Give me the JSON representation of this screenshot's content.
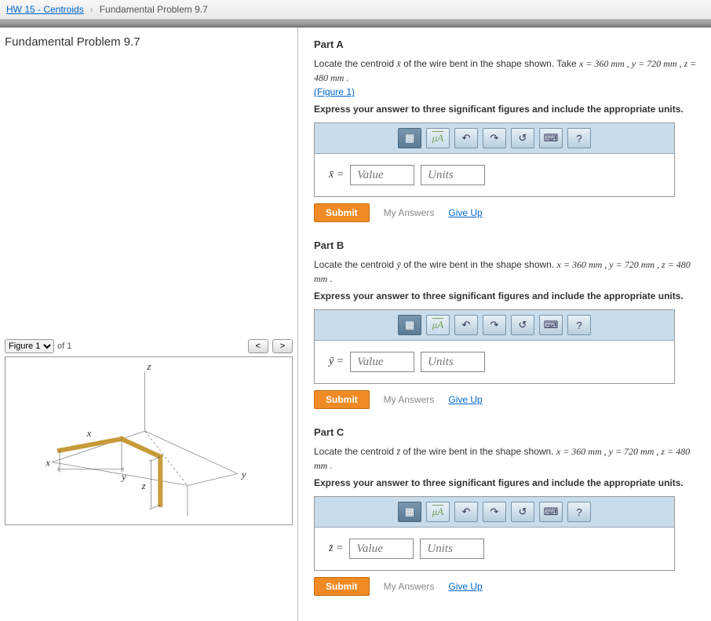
{
  "breadcrumb": {
    "back_link": "HW 15 - Centroids",
    "current": "Fundamental Problem 9.7"
  },
  "left": {
    "title": "Fundamental Problem 9.7",
    "figure_select": "Figure 1",
    "of_text": "of 1",
    "prev": "<",
    "next": ">",
    "axis_z_top": "z",
    "axis_x_left": "x",
    "axis_y_right": "y",
    "label_x": "x",
    "label_y": "y",
    "label_z": "z"
  },
  "parts": {
    "a": {
      "title": "Part A",
      "prompt_pre": "Locate the centroid ",
      "prompt_var": "x̄",
      "prompt_post": " of the wire bent in the shape shown. Take ",
      "vals": "x = 360 mm , y = 720 mm , z = 480 mm .",
      "figlink": "(Figure 1)",
      "instruct": "Express your answer to three significant figures and include the appropriate units.",
      "lhs": "x̄ =",
      "value_ph": "Value",
      "units_ph": "Units",
      "submit": "Submit",
      "my_answers": "My Answers",
      "giveup": "Give Up"
    },
    "b": {
      "title": "Part B",
      "prompt_pre": "Locate the centroid ",
      "prompt_var": "ȳ",
      "prompt_post": " of the wire bent in the shape shown. ",
      "vals": "x = 360 mm , y = 720 mm , z = 480 mm .",
      "instruct": "Express your answer to three significant figures and include the appropriate units.",
      "lhs": "ȳ =",
      "value_ph": "Value",
      "units_ph": "Units",
      "submit": "Submit",
      "my_answers": "My Answers",
      "giveup": "Give Up"
    },
    "c": {
      "title": "Part C",
      "prompt_pre": "Locate the centroid ",
      "prompt_var": "z̄",
      "prompt_post": " of the wire bent in the shape shown. ",
      "vals": "x = 360 mm , y = 720 mm , z = 480 mm .",
      "instruct": "Express your answer to three significant figures and include the appropriate units.",
      "lhs": "z̄ =",
      "value_ph": "Value",
      "units_ph": "Units",
      "submit": "Submit",
      "my_answers": "My Answers",
      "giveup": "Give Up"
    }
  },
  "tools": {
    "mu": "μA",
    "help": "?"
  }
}
